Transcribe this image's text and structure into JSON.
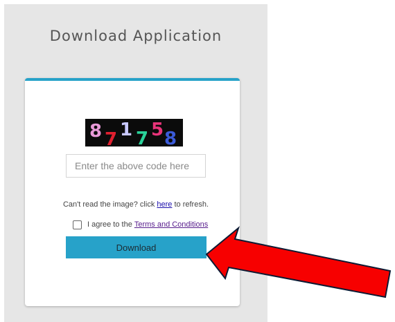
{
  "page": {
    "title": "Download Application"
  },
  "captcha": {
    "digits": [
      {
        "char": "8",
        "color": "#e89ad8"
      },
      {
        "char": "7",
        "color": "#e0202f"
      },
      {
        "char": "1",
        "color": "#c8c8ff"
      },
      {
        "char": "7",
        "color": "#2ad29a"
      },
      {
        "char": "5",
        "color": "#e9347a"
      },
      {
        "char": "8",
        "color": "#3b5bd9"
      }
    ]
  },
  "form": {
    "code_placeholder": "Enter the above code here",
    "refresh_prefix": "Can't read the image? click",
    "refresh_link": "here",
    "refresh_suffix": "to refresh.",
    "agree_prefix": "I agree to the",
    "agree_link": "Terms and Conditions",
    "download_label": "Download"
  },
  "colors": {
    "accent": "#27a2c9",
    "annotation_arrow": "#f70000"
  },
  "annotation": {
    "type": "red-arrow",
    "points_to": "download-button"
  }
}
